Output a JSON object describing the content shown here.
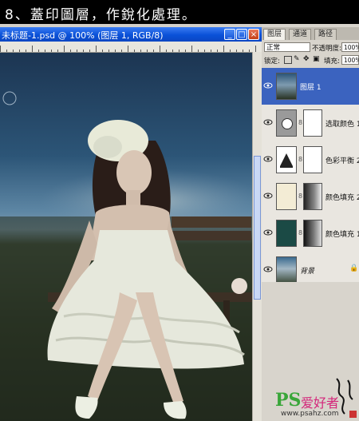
{
  "header": {
    "title": "8、蓋印圖層，作銳化處理。"
  },
  "document": {
    "title": "未标题-1.psd @ 100% (图层 1, RGB/8)",
    "buttons": {
      "minimize": "_",
      "maximize": "□",
      "close": "×"
    }
  },
  "panel": {
    "tabs": [
      "图层",
      "通道",
      "路径"
    ],
    "blend_mode": "正常",
    "opacity_label": "不透明度:",
    "opacity_value": "100%",
    "lock_label": "锁定:",
    "fill_label": "填充:",
    "fill_value": "100%",
    "layers": [
      {
        "name": "图层 1",
        "selected": true
      },
      {
        "name": "选取颜色 1",
        "selected": false
      },
      {
        "name": "色彩平衡 2",
        "selected": false
      },
      {
        "name": "颜色填充 2",
        "selected": false
      },
      {
        "name": "颜色填充 1",
        "selected": false
      },
      {
        "name": "背景",
        "selected": false
      }
    ]
  },
  "watermark": {
    "ps": "PS",
    "text": "爱好者",
    "url": "www.psahz.com"
  },
  "colors": {
    "title_blue": "#0a51d8",
    "layer_selected": "#3b63bf",
    "fill_teal": "#1b4a45",
    "fill_cream": "#f3ecd5"
  }
}
